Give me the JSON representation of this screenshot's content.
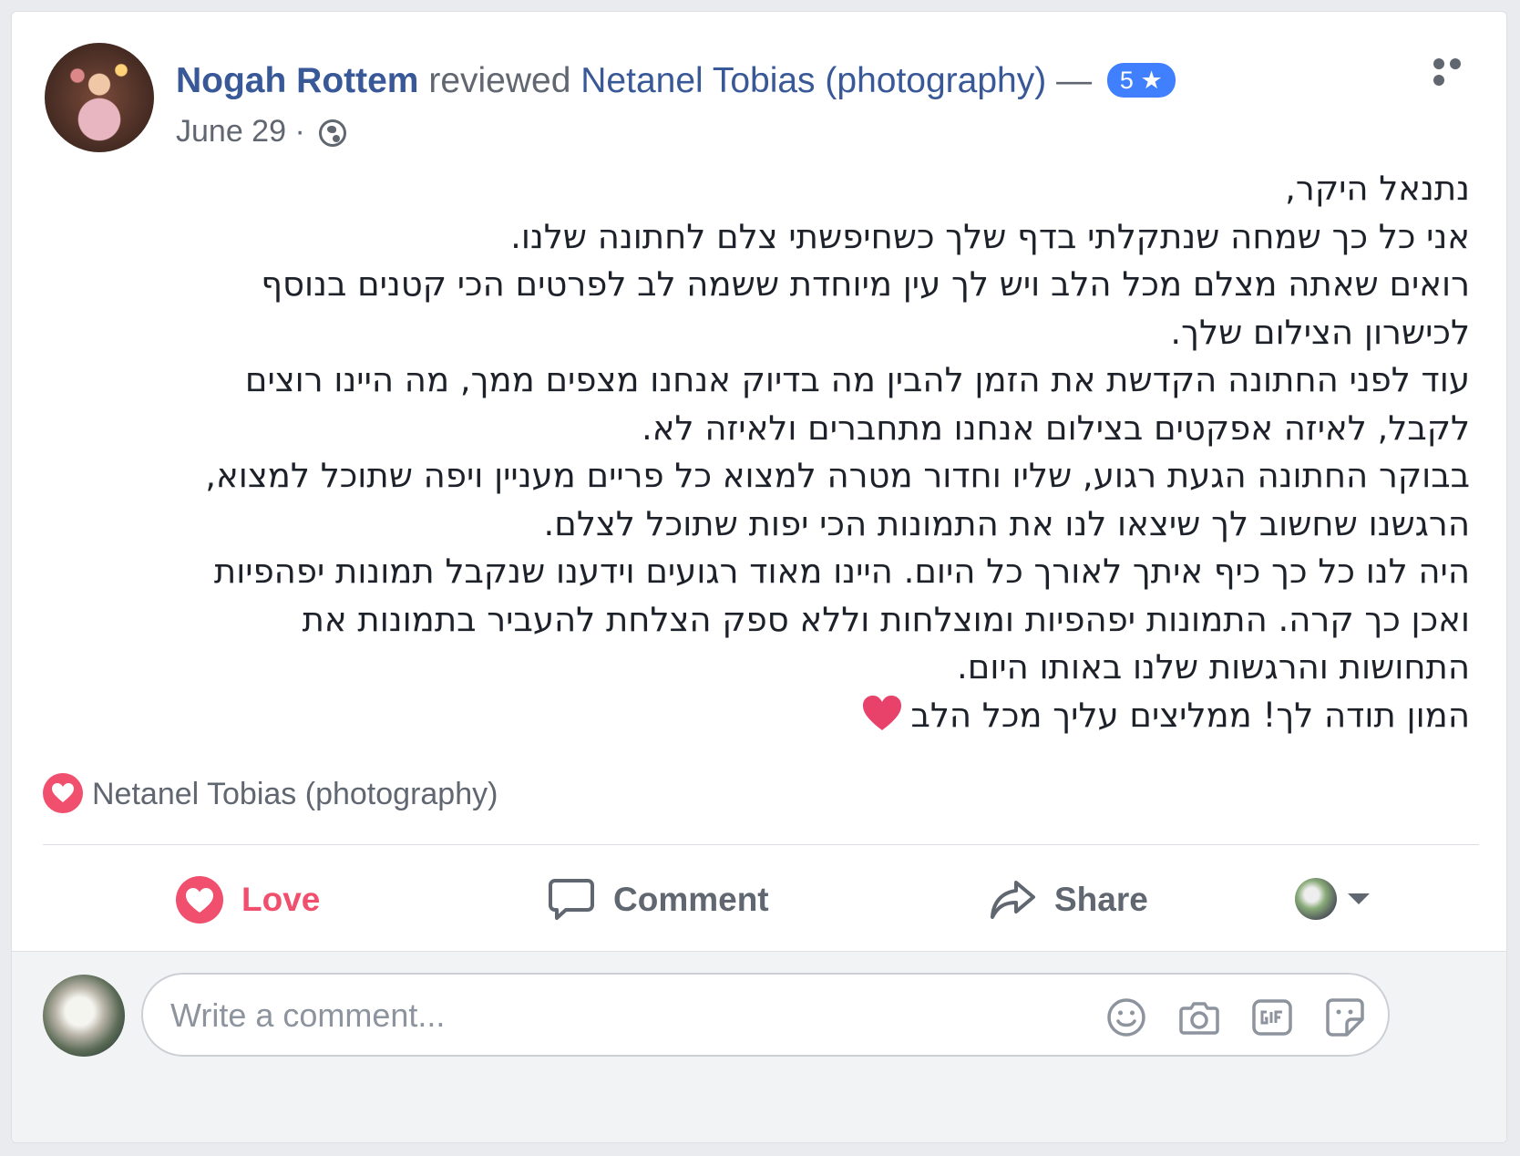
{
  "header": {
    "author": "Nogah Rottem",
    "verb": "reviewed",
    "page": "Netanel Tobias (photography)",
    "dash": "—",
    "rating": "5",
    "rating_star": "★",
    "date": "June 29",
    "separator": "·"
  },
  "review": {
    "lines": [
      "נתנאל היקר,",
      "אני כל כך שמחה שנתקלתי בדף שלך כשחיפשתי צלם לחתונה שלנו.",
      "רואים שאתה מצלם מכל הלב ויש לך עין מיוחדת ששמה לב לפרטים הכי קטנים בנוסף",
      "לכישרון הצילום שלך.",
      "עוד לפני החתונה הקדשת את הזמן להבין מה בדיוק אנחנו מצפים ממך, מה היינו רוצים",
      "לקבל, לאיזה אפקטים בצילום אנחנו מתחברים ולאיזה לא.",
      "בבוקר החתונה הגעת רגוע, שליו וחדור מטרה למצוא כל פריים מעניין ויפה שתוכל למצוא,",
      "הרגשנו שחשוב לך שיצאו לנו את התמונות הכי יפות שתוכל לצלם.",
      "היה לנו כל כך כיף איתך לאורך כל היום. היינו מאוד רגועים וידענו שנקבל תמונות יפהפיות",
      "ואכן כך קרה. התמונות יפהפיות ומוצלחות וללא ספק הצלחת להעביר בתמונות את",
      "התחושות והרגשות שלנו באותו היום.",
      "המון תודה לך! ממליצים עליך מכל הלב"
    ],
    "closing_emoji": "heart-emoji"
  },
  "reactions": {
    "reactor": "Netanel Tobias (photography)",
    "icon": "love-reaction-icon"
  },
  "actions": {
    "love": "Love",
    "comment": "Comment",
    "share": "Share"
  },
  "comment_box": {
    "placeholder": "Write a comment..."
  },
  "colors": {
    "link": "#385898",
    "love": "#f0506e",
    "badge": "#4080ff",
    "muted": "#606770"
  }
}
